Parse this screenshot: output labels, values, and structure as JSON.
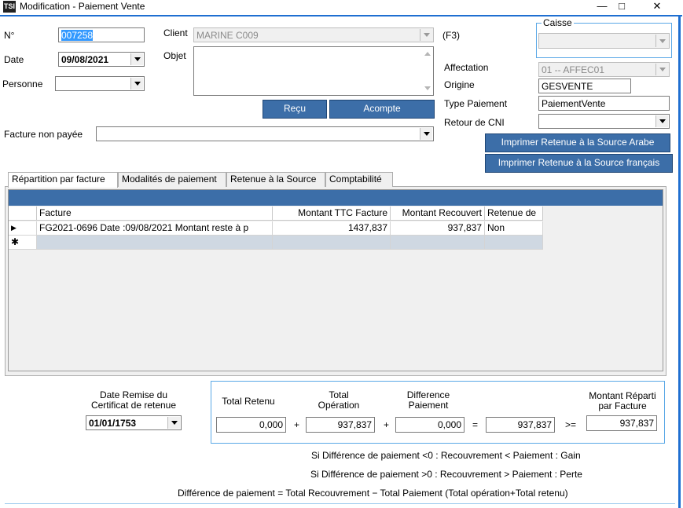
{
  "window": {
    "icon_text": "TSI",
    "title": "Modification - Paiement Vente",
    "minimize": "—",
    "maximize": "□",
    "close": "✕"
  },
  "header": {
    "numero_label": "N°",
    "numero_value": "007258",
    "date_label": "Date",
    "date_value": "09/08/2021",
    "personne_label": "Personne",
    "personne_value": "",
    "client_label": "Client",
    "client_value": "MARINE C009",
    "client_shortcut": "(F3)",
    "objet_label": "Objet",
    "objet_value": "",
    "recu_button": "Reçu",
    "acompte_button": "Acompte",
    "facture_label": "Facture non payée",
    "facture_value": ""
  },
  "right_panel": {
    "caisse_label": "Caisse",
    "caisse_value": "",
    "affectation_label": "Affectation",
    "affectation_value": "01 -- AFFEC01",
    "origine_label": "Origine",
    "origine_value": "GESVENTE",
    "type_paiement_label": "Type Paiement",
    "type_paiement_value": "PaiementVente",
    "retour_cni_label": "Retour de CNI",
    "retour_cni_value": "",
    "print_arabe_button": "Imprimer Retenue à la Source Arabe",
    "print_francais_button": "Imprimer Retenue à la Source français"
  },
  "tabs": [
    {
      "label": "Répartition par facture"
    },
    {
      "label": "Modalités de paiement"
    },
    {
      "label": "Retenue à la Source"
    },
    {
      "label": "Comptabilité"
    }
  ],
  "grid": {
    "columns": [
      "Facture",
      "Montant TTC Facture",
      "Montant Recouvert",
      "Retenue de"
    ],
    "rows": [
      {
        "indicator": "▶",
        "facture": "FG2021-0696 Date :09/08/2021 Montant reste à p",
        "montant_ttc": "1437,837",
        "montant_recouvert": "937,837",
        "retenue": "Non"
      }
    ],
    "new_row_indicator": "✱"
  },
  "footer": {
    "date_remise_label": "Date Remise du Certificat de retenue",
    "date_remise_value": "01/01/1753",
    "total_retenu_label": "Total Retenu",
    "total_retenu_value": "0,000",
    "total_operation_label": "Total Opération",
    "total_operation_value": "937,837",
    "difference_label": "Difference Paiement",
    "difference_value": "0,000",
    "result_value": "937,837",
    "montant_reparti_label": "Montant Réparti par Facture",
    "montant_reparti_value": "937,837",
    "op_plus1": "+",
    "op_plus2": "+",
    "op_equals": "=",
    "op_gte": ">=",
    "note1": "Si Différence de paiement <0 : Recouvrement < Paiement : Gain",
    "note2": "Si Différence de paiement >0 : Recouvrement > Paiement : Perte",
    "note3": "Différence de paiement = Total Recouvrement − Total Paiement (Total opération+Total retenu)"
  },
  "colors": {
    "accent_blue": "#3c6ea8",
    "frame_blue": "#5aa8e6"
  }
}
